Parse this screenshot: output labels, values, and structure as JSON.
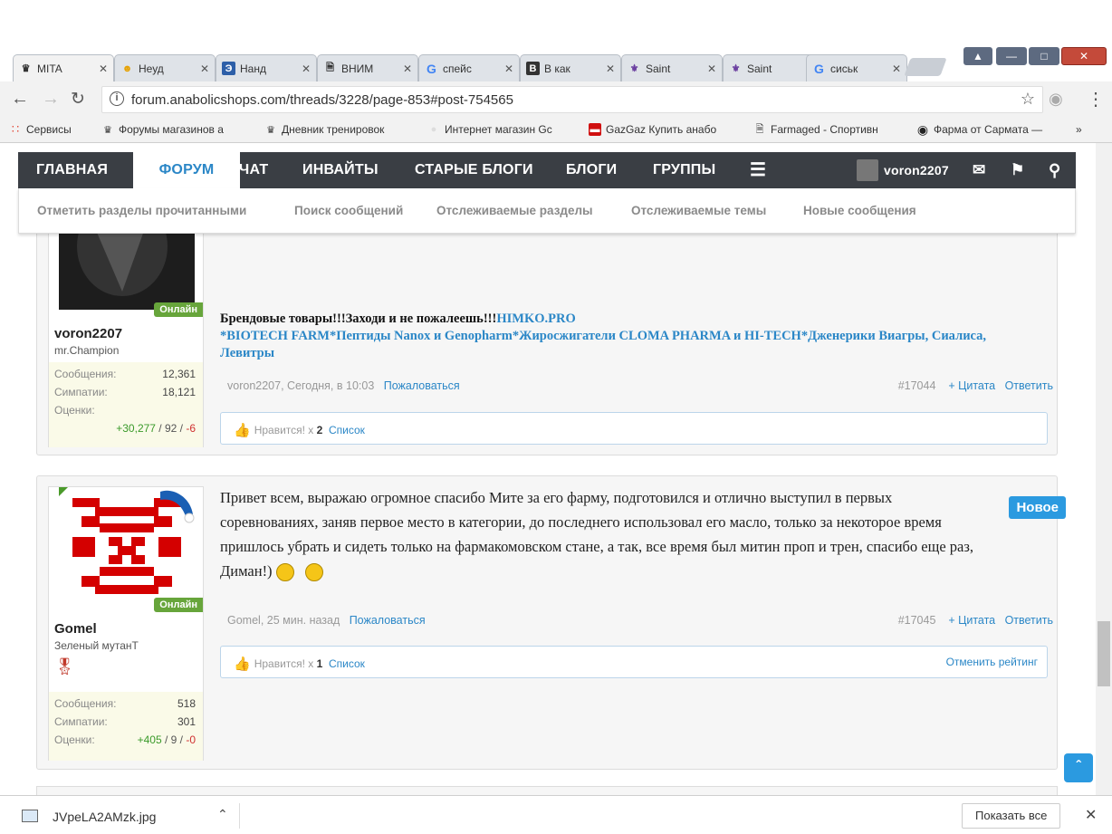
{
  "browser": {
    "tabs": [
      {
        "label": "MITA",
        "icon": "forum-icon",
        "active": true
      },
      {
        "label": "Неуд",
        "icon": "smiley-icon"
      },
      {
        "label": "Нанд",
        "icon": "document-blue-icon"
      },
      {
        "label": "ВНИМ",
        "icon": "page-icon"
      },
      {
        "label": "спейс",
        "icon": "google-icon"
      },
      {
        "label": "В как",
        "icon": "b-icon"
      },
      {
        "label": "Saint",
        "icon": "saints-icon"
      },
      {
        "label": "Saint",
        "icon": "saints-icon"
      },
      {
        "label": "сиськ",
        "icon": "google-icon"
      }
    ],
    "url": "forum.anabolicshops.com/threads/3228/page-853#post-754565",
    "bookmarks": [
      "Сервисы",
      "Форумы магазинов а",
      "Дневник тренировок",
      "Интернет магазин Gc",
      "GazGaz Купить анабо",
      "Farmaged - Спортивн",
      "Фарма от Сармата —"
    ],
    "bookmarks_more": "»"
  },
  "nav": {
    "items": [
      "ГЛАВНАЯ",
      "ФОРУМ",
      "ЧАТ",
      "ИНВАЙТЫ",
      "СТАРЫЕ БЛОГИ",
      "БЛОГИ",
      "ГРУППЫ"
    ],
    "username": "voron2207"
  },
  "subnav": [
    "Отметить разделы прочитанными",
    "Поиск сообщений",
    "Отслеживаемые разделы",
    "Отслеживаемые темы",
    "Новые сообщения"
  ],
  "posts": [
    {
      "online": "Онлайн",
      "username": "voron2207",
      "title": "mr.Champion",
      "stats": {
        "messages_label": "Сообщения:",
        "messages": "12,361",
        "likes_label": "Симпатии:",
        "likes": "18,121",
        "ratings_label": "Оценки:",
        "ratings_pos": "+30,277",
        "ratings_mid": " / 92 / ",
        "ratings_neg": "-6"
      },
      "sig_line1": "Брендовые товары!!!Заходи и не пожалеешь!!!",
      "sig_link1": "HIMKO.PRO",
      "sig_line2": "*BIOTECH FARM*Пептиды Nanox и Genopharm*Жиросжигатели CLOMA PHARMA и HI-TECH*Дженерики Виагры, Сиалиса, Левитры",
      "meta": "voron2207, Сегодня, в 10:03",
      "report": "Пожаловаться",
      "post_no": "#17044",
      "quote": "+ Цитата",
      "reply": "Ответить",
      "likes_text": "Нравится! x ",
      "likes_count": "2",
      "list": "Список"
    },
    {
      "online": "Онлайн",
      "username": "Gomel",
      "title": "Зеленый мутанТ",
      "new_badge": "Новое",
      "stats": {
        "messages_label": "Сообщения:",
        "messages": "518",
        "likes_label": "Симпатии:",
        "likes": "301",
        "ratings_label": "Оценки:",
        "ratings_pos": "+405",
        "ratings_mid": " / 9 / ",
        "ratings_neg": "-0"
      },
      "message": "Привет всем, выражаю огромное спасибо Мите за его фарму, подготовился и отлично выступил в первых соревнованиях, заняв первое место в категории, до последнего использовал его масло, только за некоторое время пришлось убрать и сидеть только на фармакомовском стане, а так, все время был митин проп и трен, спасибо еще раз, Диман!)",
      "meta": "Gomel, 25 мин. назад",
      "report": "Пожаловаться",
      "post_no": "#17045",
      "quote": "+ Цитата",
      "reply": "Ответить",
      "likes_text": "Нравится! x ",
      "likes_count": "1",
      "list": "Список",
      "unrate": "Отменить рейтинг"
    }
  ],
  "download": {
    "file": "JVpeLA2AMzk.jpg",
    "show_all": "Показать все"
  },
  "colors": {
    "accent": "#2b87c7",
    "navbar": "#3a3e44",
    "online": "#67a53b",
    "new_badge": "#2b9ae0",
    "sig_link": "#2b87c7"
  }
}
